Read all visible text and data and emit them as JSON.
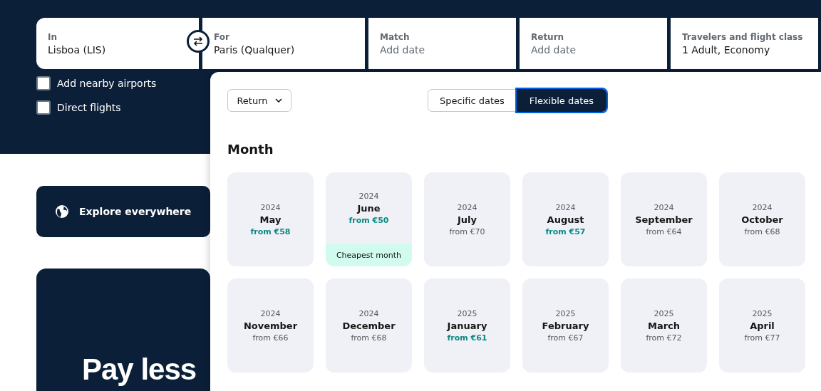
{
  "search_bar": {
    "fields": [
      {
        "label": "In",
        "value": "Lisboa (LIS)"
      },
      {
        "label": "For",
        "value": "Paris (Qualquer)"
      },
      {
        "label": "Match",
        "placeholder": "Add date"
      },
      {
        "label": "Return",
        "placeholder": "Add date"
      },
      {
        "label": "Travelers and flight class",
        "value": "1 Adult, Economy"
      }
    ]
  },
  "options": [
    {
      "label": "Add nearby airports",
      "checked": false
    },
    {
      "label": "Direct flights",
      "checked": false
    }
  ],
  "explore": {
    "label": "Explore everywhere"
  },
  "hero": {
    "title": "Pay less"
  },
  "date_picker": {
    "trip_type": "Return",
    "modes": [
      {
        "label": "Specific dates",
        "selected": false
      },
      {
        "label": "Flexible dates",
        "selected": true
      }
    ],
    "heading": "Month",
    "months": [
      {
        "year": "2024",
        "month": "May",
        "price": "from €58",
        "highlighted": true
      },
      {
        "year": "2024",
        "month": "June",
        "price": "from €50",
        "highlighted": true,
        "badge": "Cheapest month"
      },
      {
        "year": "2024",
        "month": "July",
        "price": "from €70",
        "highlighted": false
      },
      {
        "year": "2024",
        "month": "August",
        "price": "from €57",
        "highlighted": true
      },
      {
        "year": "2024",
        "month": "September",
        "price": "from €64",
        "highlighted": false
      },
      {
        "year": "2024",
        "month": "October",
        "price": "from €68",
        "highlighted": false
      },
      {
        "year": "2024",
        "month": "November",
        "price": "from €66",
        "highlighted": false
      },
      {
        "year": "2024",
        "month": "December",
        "price": "from €68",
        "highlighted": false
      },
      {
        "year": "2025",
        "month": "January",
        "price": "from €61",
        "highlighted": true
      },
      {
        "year": "2025",
        "month": "February",
        "price": "from €67",
        "highlighted": false
      },
      {
        "year": "2025",
        "month": "March",
        "price": "from €72",
        "highlighted": false
      },
      {
        "year": "2025",
        "month": "April",
        "price": "from €77",
        "highlighted": false
      }
    ]
  }
}
